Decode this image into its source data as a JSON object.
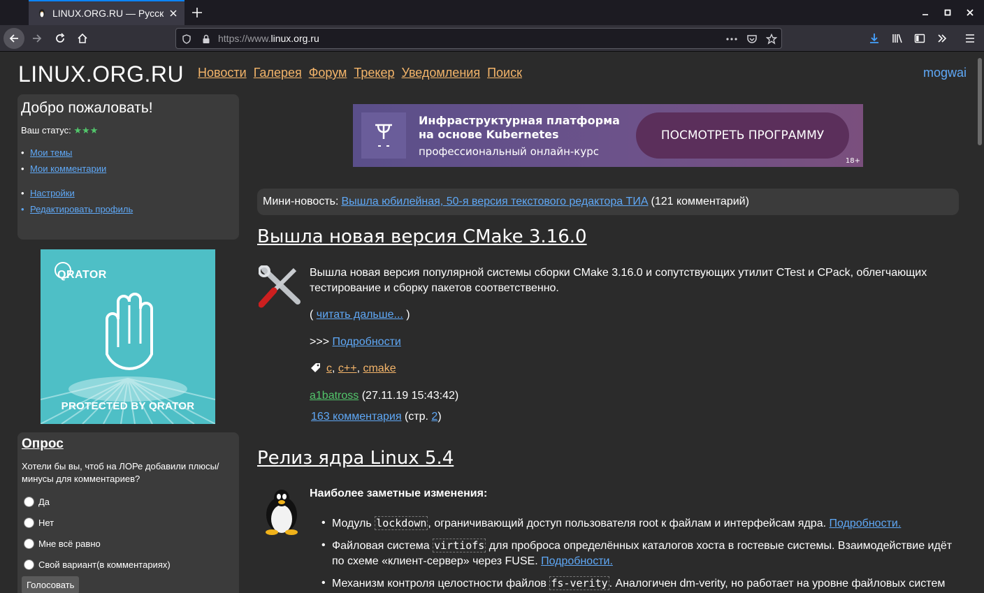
{
  "browser": {
    "tab_title": "LINUX.ORG.RU — Русская информация об ОС Linux",
    "url_prefix": "https://www.",
    "url_host": "linux.org.ru"
  },
  "site": {
    "logo": "LINUX.ORG.RU",
    "nav": [
      "Новости",
      "Галерея",
      "Форум",
      "Трекер",
      "Уведомления",
      "Поиск"
    ],
    "username": "mogwai"
  },
  "welcome": {
    "title": "Добро пожаловать!",
    "status_label": "Ваш статус:",
    "status_stars": "★★★",
    "links1": [
      "Мои темы",
      "Мои комментарии"
    ],
    "links2": [
      "Настройки",
      "Редактировать профиль"
    ]
  },
  "qrator": {
    "brand": "QRATOR",
    "footer": "PROTECTED BY QRATOR"
  },
  "poll": {
    "title": "Опрос",
    "question": "Хотели бы вы, чтоб на ЛОРе добавили плюсы/минусы для комментариев?",
    "options": [
      "Да",
      "Нет",
      "Мне всё равно",
      "Свой вариант(в комментариях)"
    ],
    "vote_button": "Голосовать"
  },
  "banner": {
    "title": "Инфраструктурная платформа\nна основе Kubernetes",
    "subtitle": "профессиональный онлайн-курс",
    "button": "ПОСМОТРЕТЬ ПРОГРАММУ",
    "age": "18+"
  },
  "mini_news": {
    "label": "Мини-новость:",
    "link": "Вышла юбилейная, 50-я версия текстового редактора ТИА",
    "comments": "(121 комментарий)"
  },
  "article1": {
    "title": "Вышла новая версия CMake 3.16.0",
    "text": "Вышла новая версия популярной системы сборки CMake 3.16.0 и сопутствующих утилит CTest и CPack, облегчающих тестирование и сборку пакетов соответственно.",
    "read_more_open": "(",
    "read_more": "читать дальше...",
    "read_more_close": ")",
    "details_prefix": ">>>",
    "details": "Подробности",
    "tags": [
      "c",
      "c++",
      "cmake"
    ],
    "author": "a1batross",
    "date": "(27.11.19 15:43:42)",
    "comments": "163 комментария",
    "pages_prefix": "(стр.",
    "page": "2",
    "pages_suffix": ")"
  },
  "article2": {
    "title": "Релиз ядра Linux 5.4",
    "heading": "Наиболее заметные изменения:",
    "items": [
      {
        "pre": "Модуль",
        "code": "lockdown",
        "post": ", ограничивающий доступ пользователя root к файлам и интерфейсам ядра.",
        "link": "Подробности."
      },
      {
        "pre": "Файловая система",
        "code": "virtiofs",
        "post": " для проброса определённых каталогов хоста в гостевые системы. Взаимодействие идёт по схеме «клиент-сервер» через FUSE.",
        "link": "Подробности."
      },
      {
        "pre": "Механизм контроля целостности файлов",
        "code": "fs-verity",
        "post": ". Аналогичен dm-verity, но работает на уровне файловых систем",
        "link": ""
      }
    ]
  },
  "colors": {
    "nav_link": "#f4b56a",
    "link": "#5fa8f6",
    "author": "#52c66b",
    "background": "#2b2b2b",
    "panel": "#3b3b3b"
  }
}
